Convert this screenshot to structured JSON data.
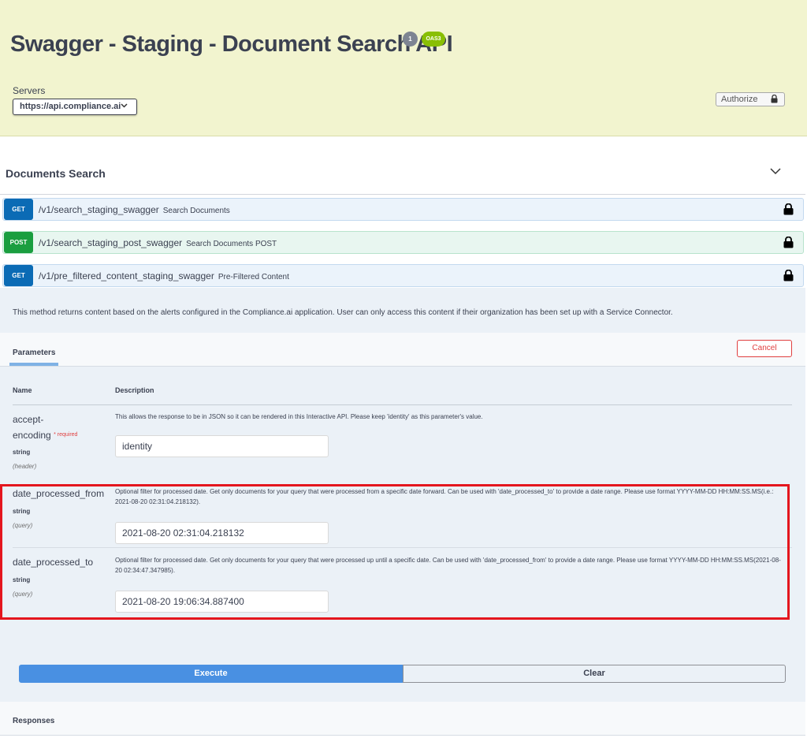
{
  "header": {
    "title": "Swagger - Staging - Document Search API",
    "version_badge": "1",
    "oas_badge": "OAS3",
    "servers_label": "Servers",
    "server_selected": "https://api.compliance.ai",
    "authorize_label": "Authorize"
  },
  "tag": {
    "title": "Documents Search"
  },
  "operations": [
    {
      "method": "GET",
      "path": "/v1/search_staging_swagger",
      "summary": "Search Documents"
    },
    {
      "method": "POST",
      "path": "/v1/search_staging_post_swagger",
      "summary": "Search Documents POST"
    },
    {
      "method": "GET",
      "path": "/v1/pre_filtered_content_staging_swagger",
      "summary": "Pre-Filtered Content"
    }
  ],
  "expanded": {
    "description": "This method returns content based on the alerts configured in the Compliance.ai application. User can only access this content if their organization has been set up with a Service Connector.",
    "parameters_tab": "Parameters",
    "cancel_label": "Cancel",
    "col_name": "Name",
    "col_description": "Description",
    "params": [
      {
        "name_line1": "accept-",
        "name_line2": "encoding",
        "required_mark": "*",
        "required_label": "required",
        "type": "string",
        "in": "(header)",
        "description": "This allows the response to be in JSON so it can be rendered in this Interactive API. Please keep 'identity' as this parameter's value.",
        "value": "identity"
      },
      {
        "name": "date_processed_from",
        "type": "string",
        "in": "(query)",
        "description": "Optional filter for processed date. Get only documents for your query that were processed from a specific date forward. Can be used with 'date_processed_to' to provide a date range. Please use format YYYY-MM-DD HH:MM:SS.MS(i.e.: 2021-08-20 02:31:04.218132).",
        "value": "2021-08-20 02:31:04.218132"
      },
      {
        "name": "date_processed_to",
        "type": "string",
        "in": "(query)",
        "description": "Optional filter for processed date. Get only documents for your query that were processed up until a specific date. Can be used with 'date_processed_from' to provide a date range. Please use format YYYY-MM-DD HH:MM:SS.MS(2021-08-20 02:34:47.347985).",
        "value": "2021-08-20 19:06:34.887400"
      }
    ],
    "execute_label": "Execute",
    "clear_label": "Clear",
    "responses_label": "Responses"
  },
  "colors": {
    "header_bg": "#f2f4cf",
    "get": "#0b6bb5",
    "post": "#1a9e3f",
    "execute": "#4990e2",
    "highlight": "#e4161e",
    "cancel": "#e03f3f"
  }
}
